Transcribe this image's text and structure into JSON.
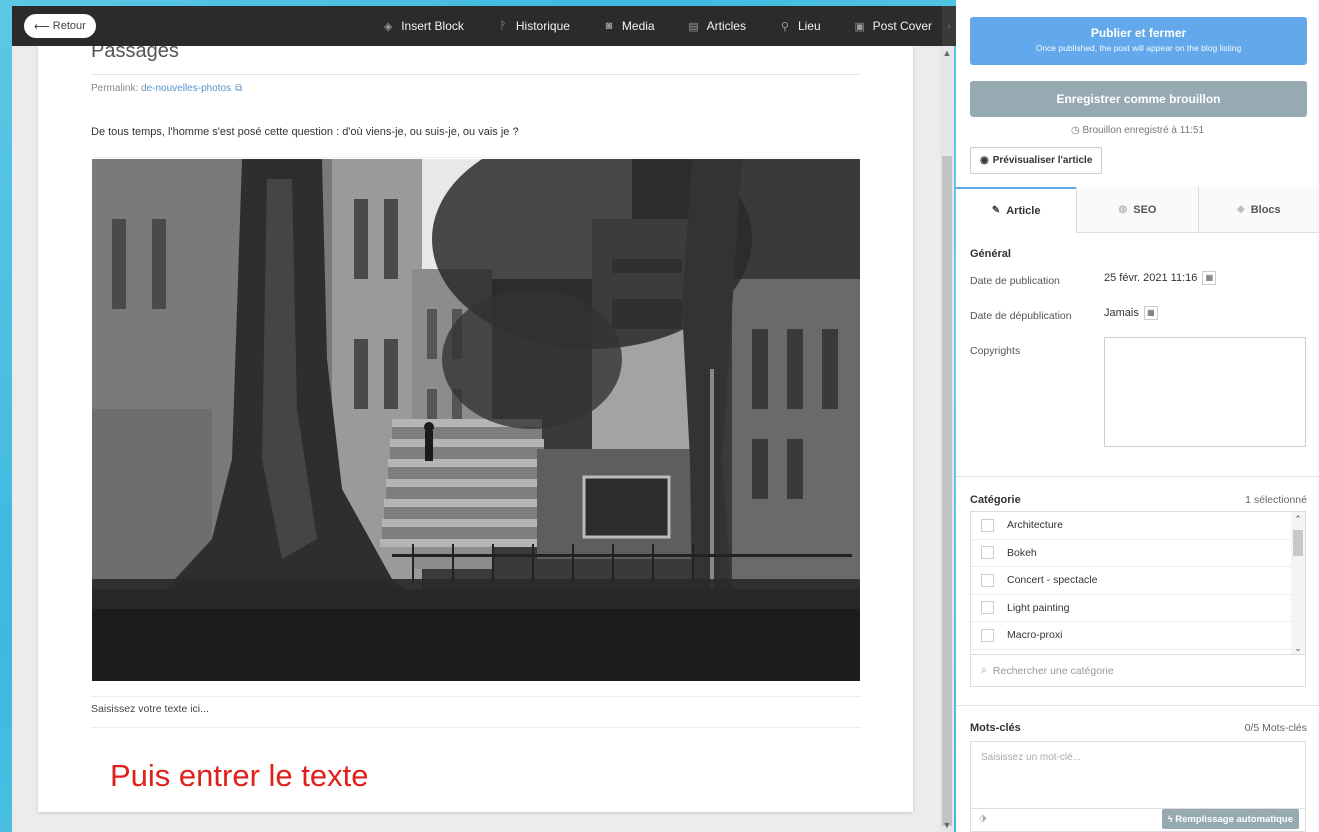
{
  "toolbar": {
    "back_label": "Retour",
    "items": [
      {
        "label": "Insert Block",
        "icon": "cube-icon"
      },
      {
        "label": "Historique",
        "icon": "history-icon"
      },
      {
        "label": "Media",
        "icon": "camera-icon"
      },
      {
        "label": "Articles",
        "icon": "file-icon"
      },
      {
        "label": "Lieu",
        "icon": "map-pin-icon"
      },
      {
        "label": "Post Cover",
        "icon": "image-icon"
      }
    ]
  },
  "editor": {
    "title": "Passages",
    "permalink_label": "Permalink:",
    "permalink_slug": "de-nouvelles-photos",
    "paragraph": "De tous temps, l'homme s'est posé cette question : d'où viens-je, ou suis-je, ou vais je ?",
    "text_placeholder": "Saisissez votre texte ici...",
    "annotation": "Puis entrer le texte"
  },
  "sidebar": {
    "publish": {
      "label": "Publier et fermer",
      "sublabel": "Once published, the post will appear on the blog listing"
    },
    "draft_label": "Enregistrer comme brouillon",
    "saved_note": "Brouillon enregistré à 11:51",
    "preview_label": "Prévisualiser l'article",
    "tabs": [
      {
        "label": "Article",
        "icon": "pencil-icon"
      },
      {
        "label": "SEO",
        "icon": "globe-icon"
      },
      {
        "label": "Blocs",
        "icon": "cube-icon"
      }
    ],
    "general": {
      "heading": "Général",
      "pub_date_label": "Date de publication",
      "pub_date_value": "25 févr. 2021 11:16",
      "unpub_date_label": "Date de dépublication",
      "unpub_date_value": "Jamais",
      "copyrights_label": "Copyrights"
    },
    "category": {
      "heading": "Catégorie",
      "count": "1 sélectionné",
      "items": [
        "Architecture",
        "Bokeh",
        "Concert - spectacle",
        "Light painting",
        "Macro-proxi"
      ],
      "search_placeholder": "Rechercher une catégorie"
    },
    "keywords": {
      "heading": "Mots-clés",
      "count": "0/5 Mots-clés",
      "placeholder": "Saisissez un mot-clé...",
      "auto_label": "Remplissage automatique"
    }
  }
}
